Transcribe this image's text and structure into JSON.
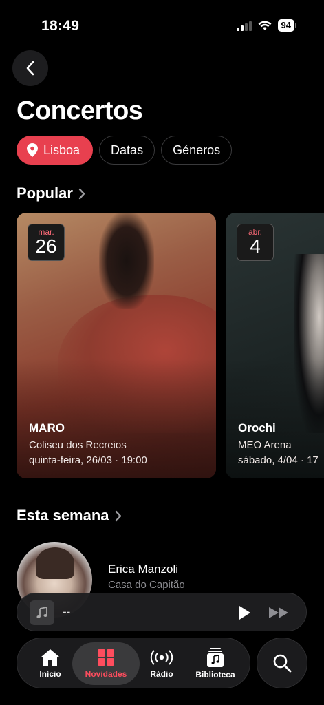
{
  "status": {
    "time": "18:49",
    "battery": "94"
  },
  "page": {
    "title": "Concertos"
  },
  "filters": {
    "location": "Lisboa",
    "dates": "Datas",
    "genres": "Géneros"
  },
  "sections": {
    "popular": "Popular",
    "this_week": "Esta semana"
  },
  "popular_cards": [
    {
      "month": "mar.",
      "day": "26",
      "artist": "MARO",
      "venue": "Coliseu dos Recreios",
      "time": "quinta-feira, 26/03 · 19:00"
    },
    {
      "month": "abr.",
      "day": "4",
      "artist": "Orochi",
      "venue": "MEO Arena",
      "time": "sábado, 4/04 · 17"
    }
  ],
  "this_week": [
    {
      "artist": "Erica Manzoli",
      "venue": "Casa do Capitão"
    }
  ],
  "mini_player": {
    "title": "--"
  },
  "tabs": [
    {
      "label": "Início",
      "icon": "home-icon",
      "active": false
    },
    {
      "label": "Novidades",
      "icon": "grid-icon",
      "active": true
    },
    {
      "label": "Rádio",
      "icon": "radio-icon",
      "active": false
    },
    {
      "label": "Biblioteca",
      "icon": "library-icon",
      "active": false
    }
  ],
  "colors": {
    "accent": "#e8404f",
    "background": "#000000",
    "tab_active": "#ff4d5e"
  }
}
